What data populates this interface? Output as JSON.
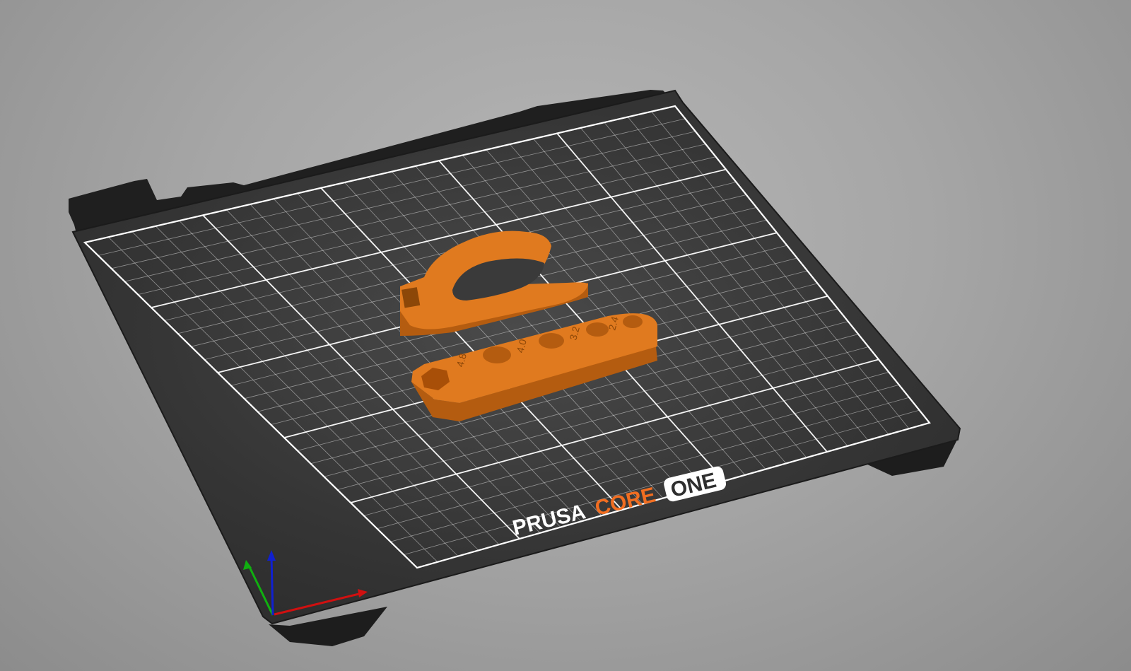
{
  "bed": {
    "logo_word1": "PRUSA",
    "logo_word2": "CORE",
    "logo_word3": "ONE"
  },
  "wrench": {
    "labels": [
      "4.8",
      "4.0",
      "3.2",
      "2.4"
    ]
  },
  "colors": {
    "background": "#a6a6a6",
    "bed_plate": "#2e2e2e",
    "bed_frame": "#1f1f1f",
    "grid": "#ffffff",
    "model_orange": "#e07a1f",
    "model_orange_dark": "#b45c10",
    "logo_orange": "#f26e21",
    "axis_x": "#d01010",
    "axis_y": "#10b010",
    "axis_z": "#1020d0"
  }
}
